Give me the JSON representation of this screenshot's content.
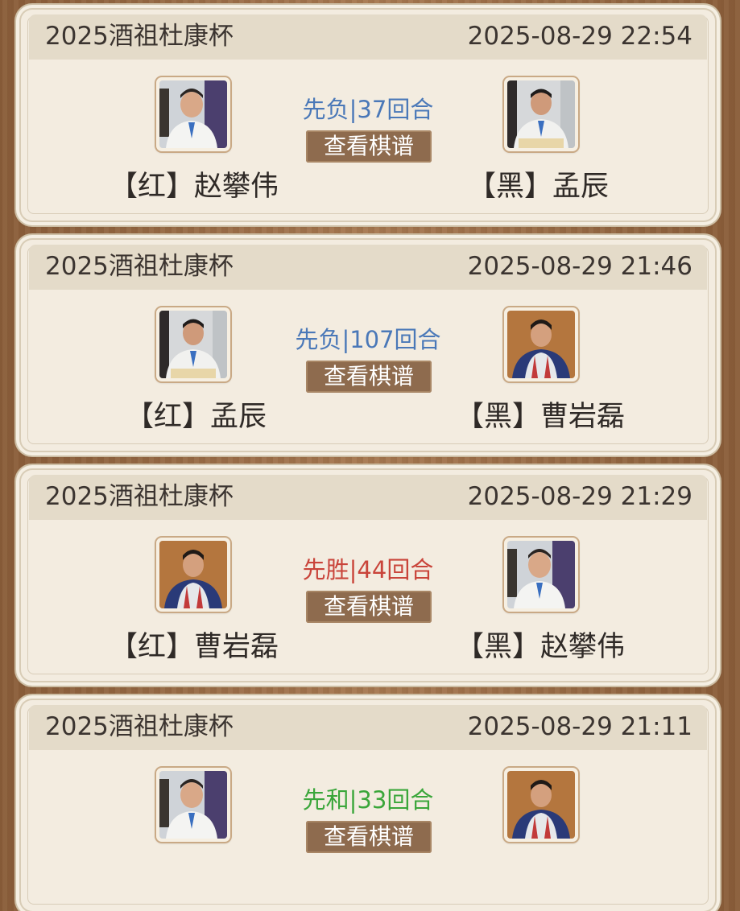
{
  "matches": [
    {
      "title": "2025酒祖杜康杯",
      "time": "2025-08-29 22:54",
      "result": "先负|37回合",
      "result_color": "#4a78b8",
      "button": "查看棋谱",
      "red": "【红】赵攀伟",
      "black": "【黑】孟辰"
    },
    {
      "title": "2025酒祖杜康杯",
      "time": "2025-08-29 21:46",
      "result": "先负|107回合",
      "result_color": "#4a78b8",
      "button": "查看棋谱",
      "red": "【红】孟辰",
      "black": "【黑】曹岩磊"
    },
    {
      "title": "2025酒祖杜康杯",
      "time": "2025-08-29 21:29",
      "result": "先胜|44回合",
      "result_color": "#c9443a",
      "button": "查看棋谱",
      "red": "【红】曹岩磊",
      "black": "【黑】赵攀伟"
    },
    {
      "title": "2025酒祖杜康杯",
      "time": "2025-08-29 21:11",
      "result": "先和|33回合",
      "result_color": "#3aa63a",
      "button": "查看棋谱",
      "red": "",
      "black": ""
    }
  ]
}
